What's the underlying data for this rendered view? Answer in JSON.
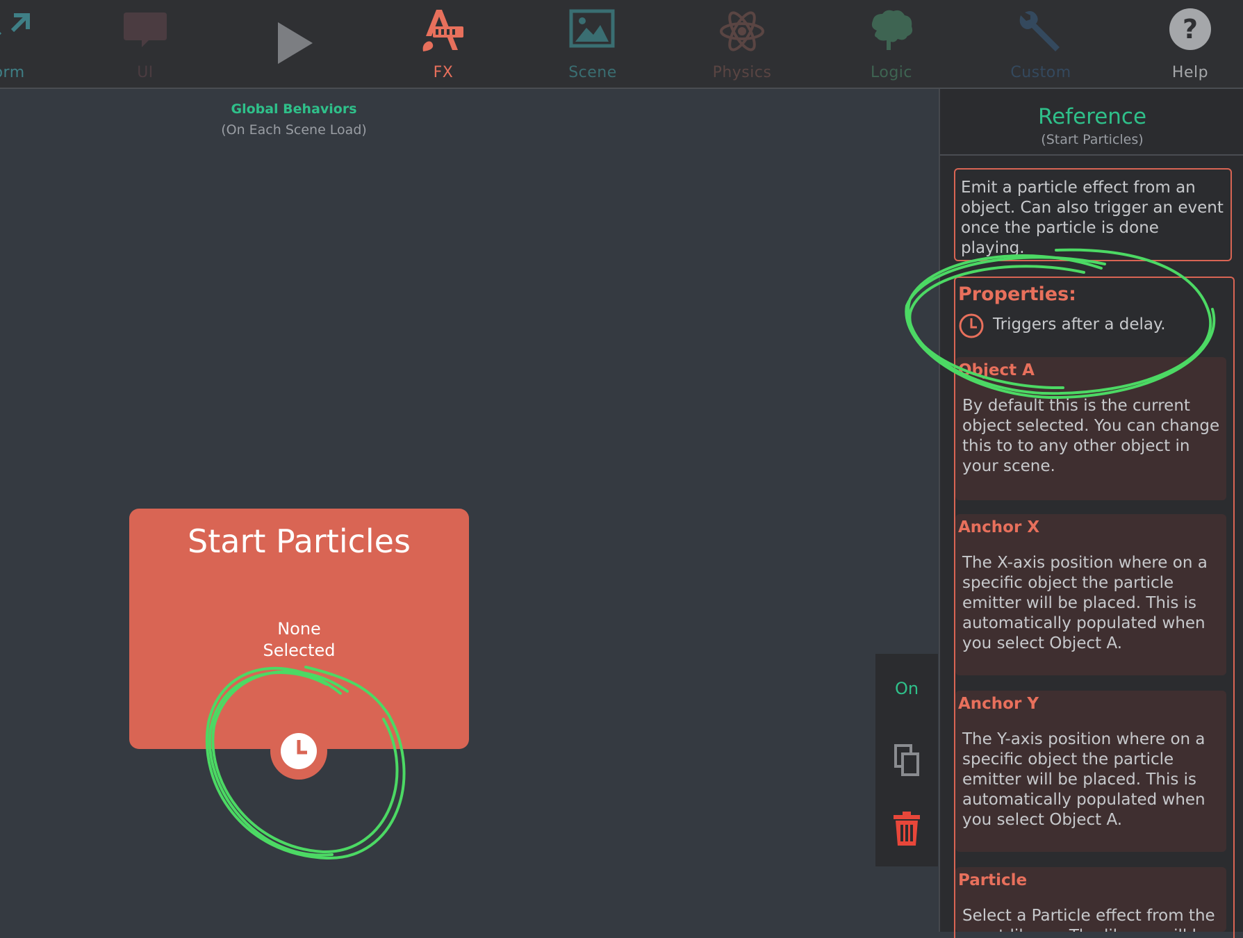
{
  "toolbar": {
    "items": [
      {
        "label": "form",
        "icon": "expand-arrows-icon",
        "color": "#3f7f86"
      },
      {
        "label": "UI",
        "icon": "speech-bubble-icon",
        "color": "#4b3c41"
      },
      {
        "label": "",
        "icon": "play-icon",
        "color": "#7c7e82"
      },
      {
        "label": "FX",
        "icon": "fx-brush-icon",
        "color": "#e8705c",
        "active": true
      },
      {
        "label": "Scene",
        "icon": "image-icon",
        "color": "#3a6e72"
      },
      {
        "label": "Physics",
        "icon": "atom-icon",
        "color": "#5a4543"
      },
      {
        "label": "Logic",
        "icon": "brain-icon",
        "color": "#3e6452"
      },
      {
        "label": "Custom",
        "icon": "wrench-icon",
        "color": "#34495e"
      },
      {
        "label": "Help",
        "icon": "help-icon",
        "color": "#a5a7aa"
      }
    ]
  },
  "canvas": {
    "global_title": "Global Behaviors",
    "global_sub": "(On Each Scene Load)",
    "card": {
      "title": "Start Particles",
      "value_line1": "None",
      "value_line2": "Selected"
    }
  },
  "side_controls": {
    "toggle_label": "On"
  },
  "reference": {
    "title": "Reference",
    "subtitle": "(Start Particles)",
    "description": "Emit a particle effect from an object. Can also trigger an event once the particle is done playing.",
    "properties_title": "Properties:",
    "delay_text": "Triggers after a delay.",
    "properties": [
      {
        "name": "Object A",
        "desc": "By default this is the current object selected. You can change this to to any other object in your scene."
      },
      {
        "name": "Anchor X",
        "desc": "The X-axis position where on a specific object the particle emitter will be placed. This is automatically populated when you select Object A."
      },
      {
        "name": "Anchor Y",
        "desc": "The Y-axis position where on a specific object the particle emitter will be placed. This is automatically populated when you select Object A."
      },
      {
        "name": "Particle",
        "desc": "Select a Particle effect from the asset library. The library will be"
      }
    ]
  },
  "colors": {
    "accent_green": "#2fc08a",
    "accent_red": "#e8705c",
    "card_red": "#d96554",
    "annotation_green": "#4cd964"
  }
}
